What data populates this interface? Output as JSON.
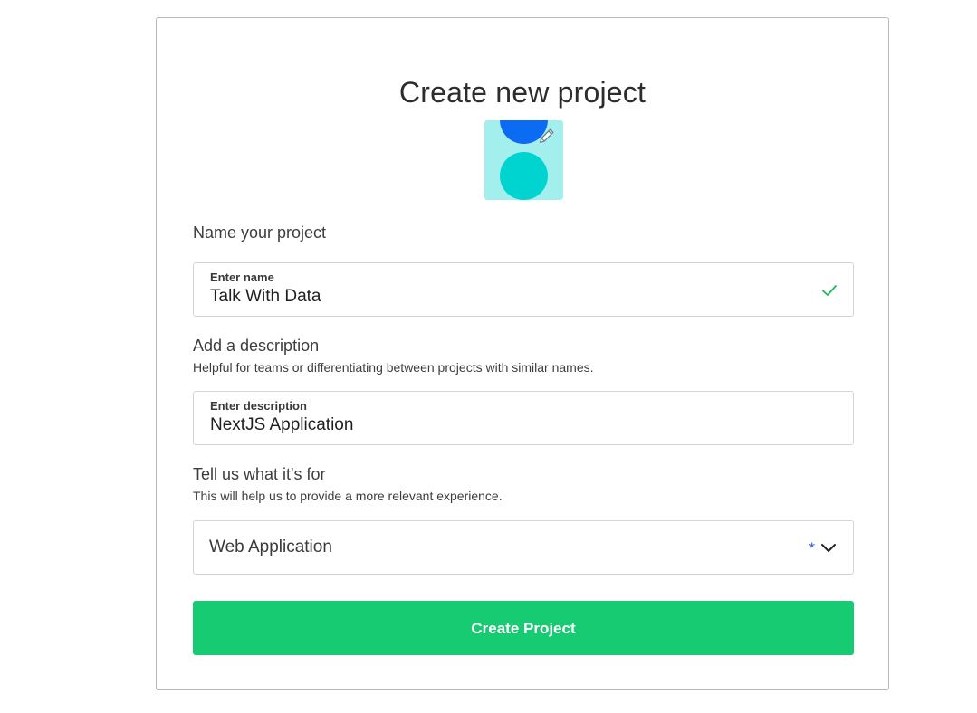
{
  "title": "Create new project",
  "avatar": {
    "icon": "edit-pencil-icon",
    "colors": {
      "background": "#a3efed",
      "circle_top": "#0b6cf3",
      "circle_bottom": "#00d4d0"
    }
  },
  "name_section": {
    "label": "Name your project",
    "field_label": "Enter name",
    "value": "Talk With Data",
    "valid_icon": "check-icon",
    "valid_color": "#1db954"
  },
  "description_section": {
    "label": "Add a description",
    "hint": "Helpful for teams or differentiating between projects with similar names.",
    "field_label": "Enter description",
    "value": "NextJS Application"
  },
  "purpose_section": {
    "label": "Tell us what it's for",
    "hint": "This will help us to provide a more relevant experience.",
    "selected": "Web Application",
    "required_marker": "*",
    "dropdown_icon": "chevron-down-icon"
  },
  "submit": {
    "label": "Create Project",
    "color": "#17cb73"
  }
}
